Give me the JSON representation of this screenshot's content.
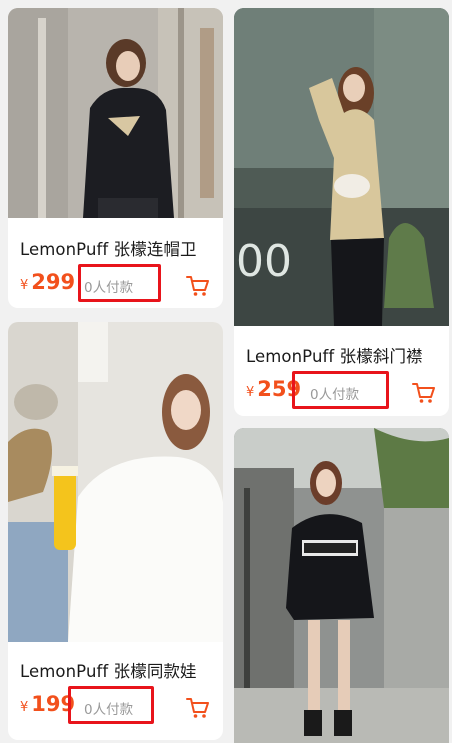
{
  "products": [
    {
      "title": "LemonPuff 张檬连帽卫",
      "currency": "¥",
      "price": "299",
      "sold": "0人付款",
      "image": "woman-in-black-hoodie-photo"
    },
    {
      "title": "LemonPuff 张檬斜门襟",
      "currency": "¥",
      "price": "259",
      "sold": "0人付款",
      "image": "woman-in-beige-shirt-photo"
    },
    {
      "title": "LemonPuff 张檬同款娃",
      "currency": "¥",
      "price": "199",
      "sold": "0人付款",
      "image": "woman-in-white-blouse-photo"
    },
    {
      "title": "",
      "currency": "",
      "price": "",
      "sold": "",
      "image": "woman-in-black-sweatshirt-photo"
    }
  ],
  "icons": {
    "cart": "shopping-cart-icon"
  },
  "colors": {
    "price": "#f2501c",
    "highlight": "#e8141b",
    "background": "#f1f1f1"
  }
}
